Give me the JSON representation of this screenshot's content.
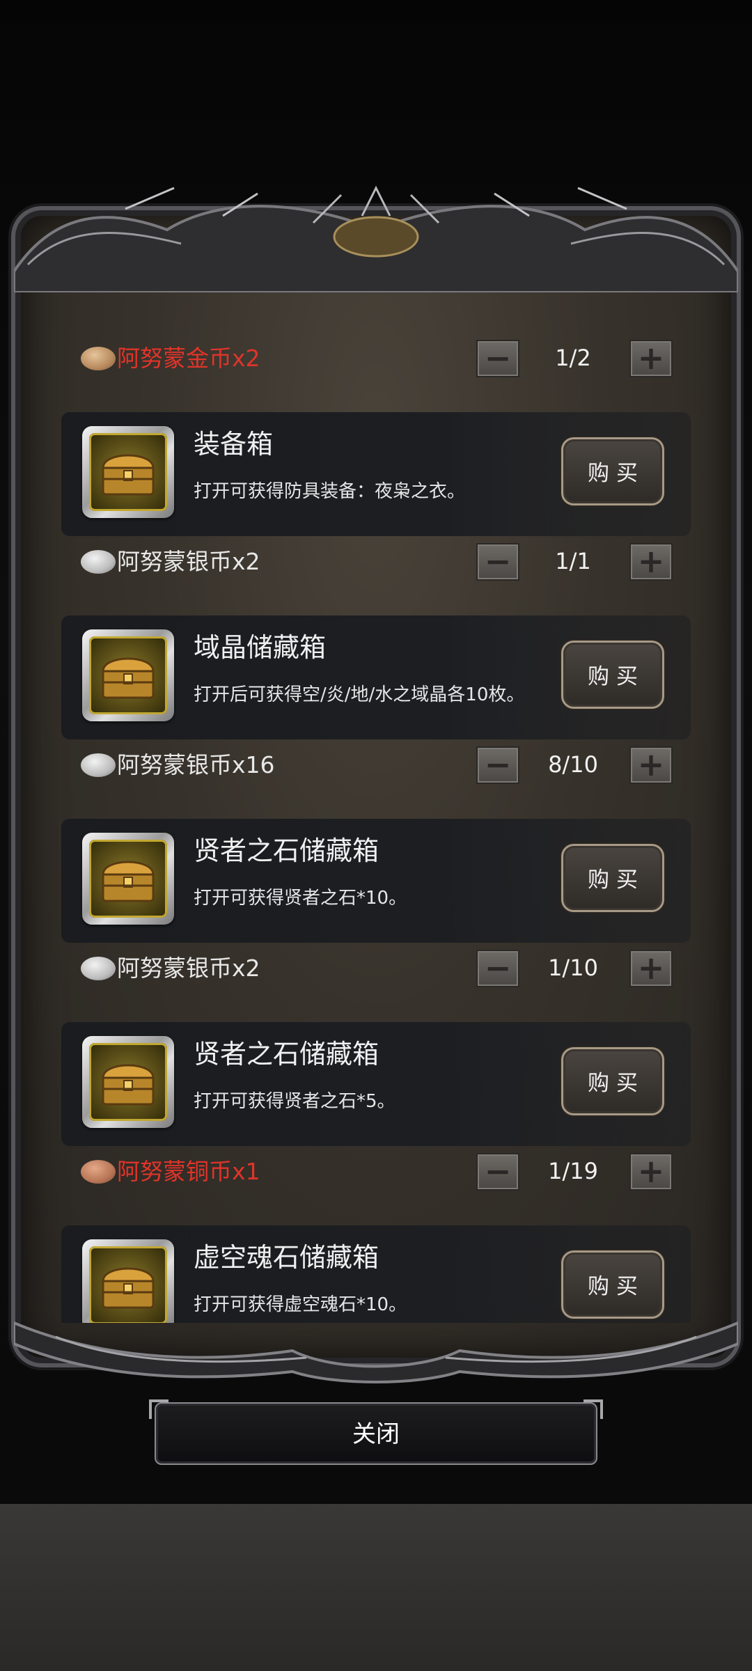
{
  "rows": [
    {
      "price": {
        "coin": "gold",
        "label": "阿努蒙金币x2",
        "label_color": "#e0342a",
        "counter": "1/2"
      },
      "item": {
        "title": "装备箱",
        "desc": "打开可获得防具装备：夜枭之衣。",
        "buy_label": "购买"
      }
    },
    {
      "price": {
        "coin": "silver",
        "label": "阿努蒙银币x2",
        "label_color": "#e8e8e8",
        "counter": "1/1"
      },
      "item": {
        "title": "域晶储藏箱",
        "desc": "打开后可获得空/炎/地/水之域晶各10枚。",
        "buy_label": "购买"
      }
    },
    {
      "price": {
        "coin": "silver",
        "label": "阿努蒙银币x16",
        "label_color": "#e8e8e8",
        "counter": "8/10"
      },
      "item": {
        "title": "贤者之石储藏箱",
        "desc": "打开可获得贤者之石*10。",
        "buy_label": "购买"
      }
    },
    {
      "price": {
        "coin": "silver",
        "label": "阿努蒙银币x2",
        "label_color": "#e8e8e8",
        "counter": "1/10"
      },
      "item": {
        "title": "贤者之石储藏箱",
        "desc": "打开可获得贤者之石*5。",
        "buy_label": "购买"
      }
    },
    {
      "price": {
        "coin": "copper",
        "label": "阿努蒙铜币x1",
        "label_color": "#e0342a",
        "counter": "1/19"
      },
      "item": {
        "title": "虚空魂石储藏箱",
        "desc": "打开可获得虚空魂石*10。",
        "buy_label": "购买"
      }
    }
  ],
  "stepper": {
    "minus_symbol": "−",
    "plus_symbol": "+"
  },
  "close_label": "关闭",
  "colors": {
    "accent_red": "#e0342a",
    "panel_brown": "#37322b",
    "card_dark": "#1c1e22"
  }
}
